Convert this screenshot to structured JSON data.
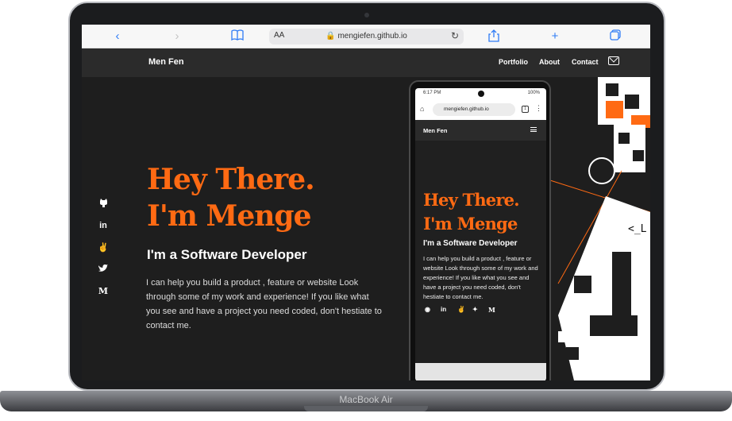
{
  "device": {
    "label": "MacBook Air"
  },
  "browser": {
    "text_size_label": "AA",
    "url": "mengiefen.github.io",
    "buttons": [
      "back-icon",
      "forward-icon",
      "bookmarks-icon",
      "reload-icon",
      "share-icon",
      "new-tab-icon",
      "tabs-icon"
    ]
  },
  "site": {
    "brand": "Men Fen",
    "nav": [
      "Portfolio",
      "About",
      "Contact"
    ],
    "hero": {
      "title_line1": "Hey There.",
      "title_line2": "I'm Menge",
      "subtitle": "I'm a Software Developer",
      "body": "I can help you build a product , feature or website Look through some of my work and experience! If you like what you see and have a project you need coded, don't hestiate to contact me."
    },
    "social": [
      {
        "icon": "github-icon",
        "glyph": "🐙"
      },
      {
        "icon": "linkedin-icon",
        "glyph": "in"
      },
      {
        "icon": "angellist-icon",
        "glyph": "✌"
      },
      {
        "icon": "twitter-icon",
        "glyph": "🐦"
      },
      {
        "icon": "medium-icon",
        "glyph": "M"
      }
    ],
    "accent_color": "#ff6a13"
  },
  "phone": {
    "time": "6:17 PM",
    "battery": "100%",
    "url": "mengiefen.github.io",
    "tab_count": "1",
    "brand": "Men Fen",
    "title_line1": "Hey There.",
    "title_line2": "I'm Menge",
    "subtitle": "I'm a Software Developer",
    "body": "I can help you build a product , feature or website Look through some of my work and experience! If you like what you see and have a project you need coded, don't hestiate to contact me."
  }
}
